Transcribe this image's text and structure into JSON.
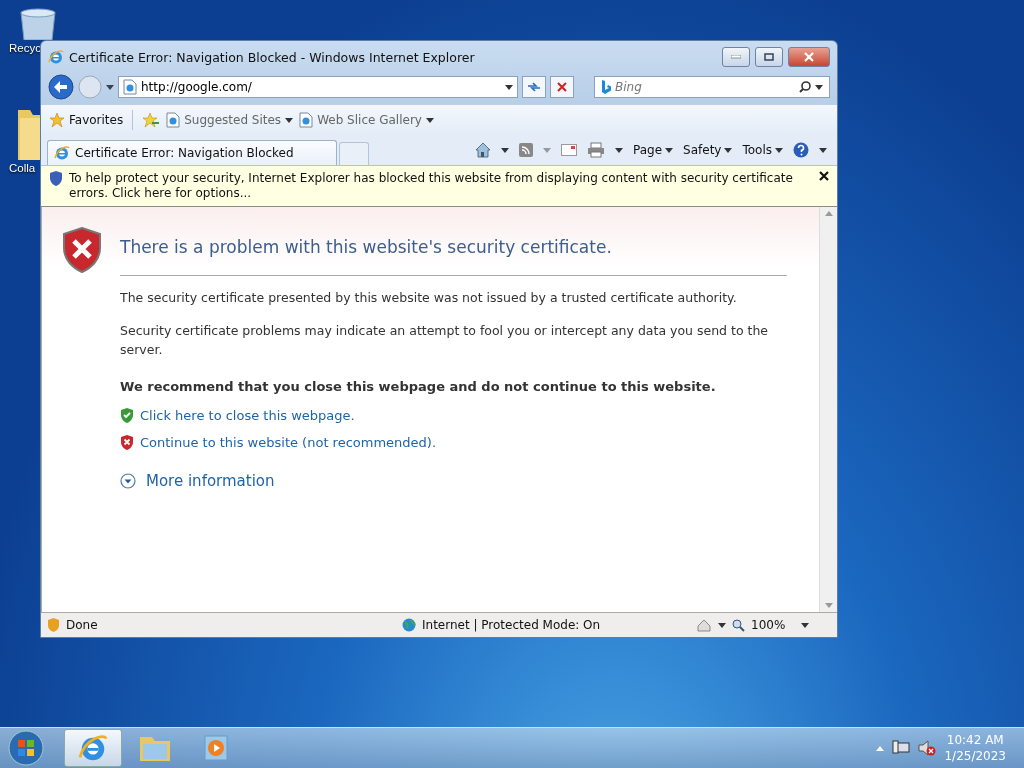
{
  "desktop_icons": [
    {
      "kind": "recycle",
      "label": "Recyc"
    },
    {
      "kind": "folder",
      "label": "Colla"
    }
  ],
  "window": {
    "title": "Certificate Error: Navigation Blocked - Windows Internet Explorer",
    "address": "http://google.com/",
    "search_placeholder": "Bing",
    "favorites_bar": [
      {
        "kind": "favorites",
        "label": "Favorites"
      },
      {
        "kind": "page",
        "label": "Suggested Sites"
      },
      {
        "kind": "page",
        "label": "Web Slice Gallery"
      }
    ],
    "tabs": [
      {
        "label": "Certificate Error: Navigation Blocked",
        "selected": true
      }
    ],
    "command_bar": [
      "Page",
      "Safety",
      "Tools"
    ],
    "info_bar": "To help protect your security, Internet Explorer has blocked this website from displaying content with security certificate errors. Click here for options...",
    "page": {
      "heading": "There is a problem with this website's security certificate.",
      "paragraphs": [
        "The security certificate presented by this website was not issued by a trusted certificate authority.",
        "Security certificate problems may indicate an attempt to fool you or intercept any data you send to the server."
      ],
      "recommendation": "We recommend that you close this webpage and do not continue to this website.",
      "links": [
        {
          "kind": "safe",
          "text": "Click here to close this webpage."
        },
        {
          "kind": "unsafe",
          "text": "Continue to this website (not recommended)."
        }
      ],
      "more_info": "More information"
    },
    "status_bar": {
      "status": "Done",
      "zone": "Internet | Protected Mode: On",
      "zoom": "100%"
    }
  },
  "taskbar": {
    "items": [
      {
        "kind": "browser",
        "selected": true
      },
      {
        "kind": "folder",
        "selected": false
      },
      {
        "kind": "media",
        "selected": false
      }
    ],
    "time": "10:42 AM",
    "date": "1/25/2023"
  }
}
